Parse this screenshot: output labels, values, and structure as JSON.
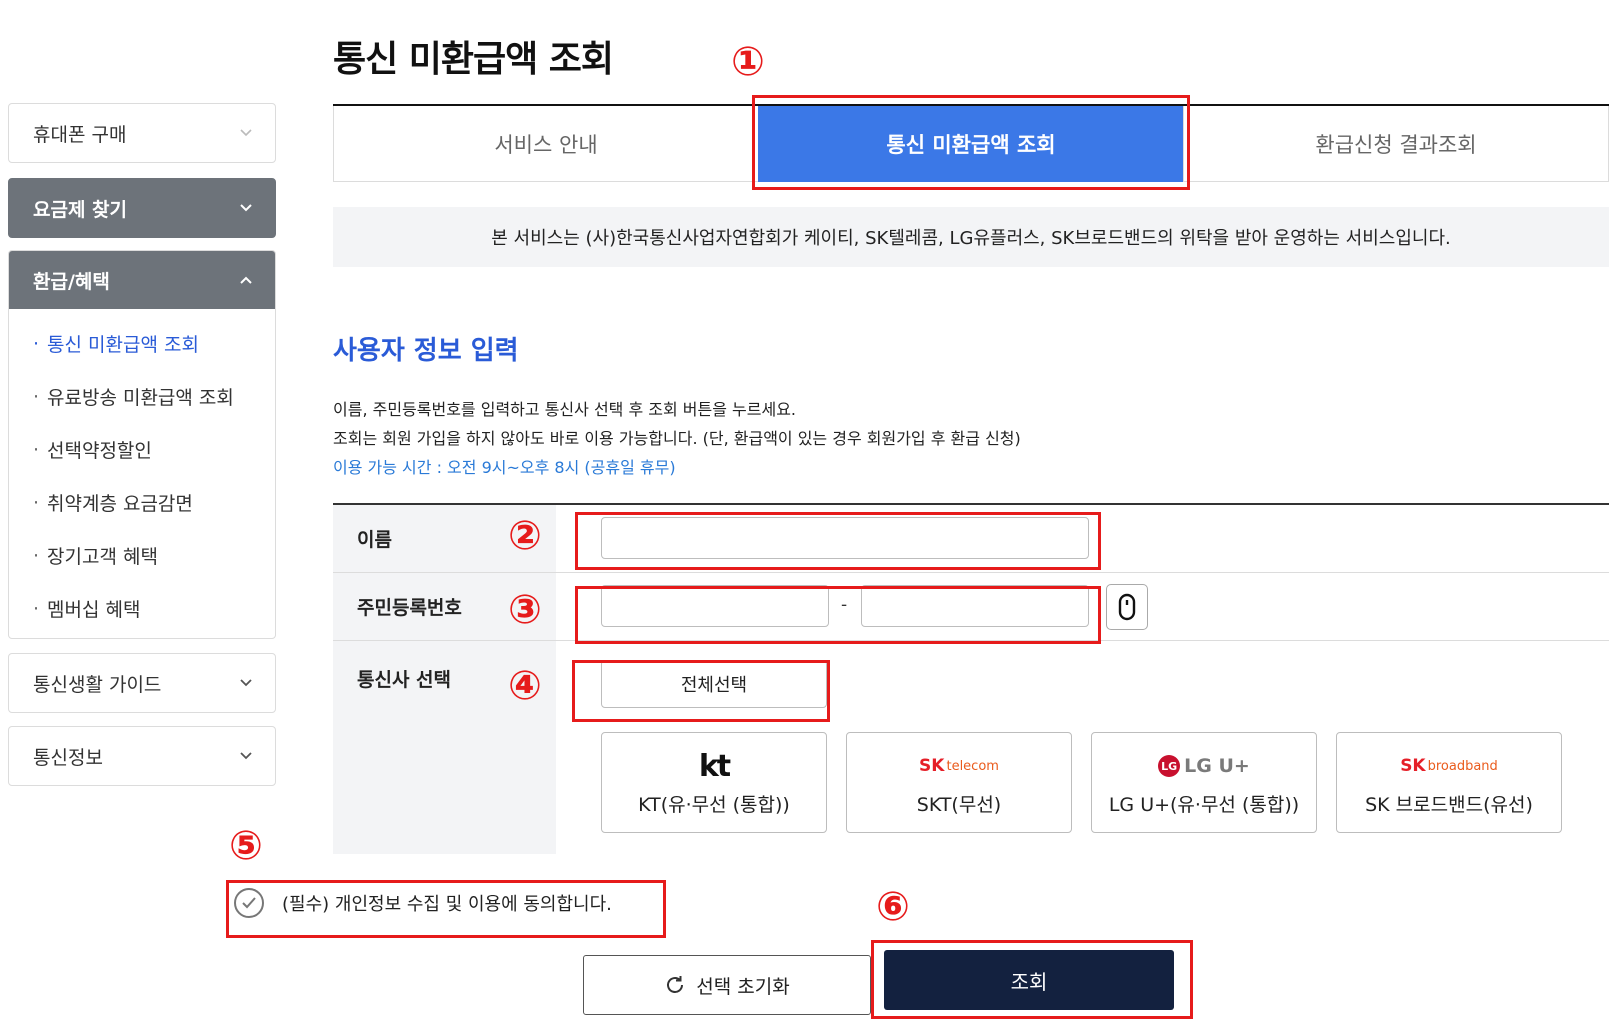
{
  "sidebar": {
    "menu1": "휴대폰 구매",
    "menu2": "요금제 찾기",
    "menu3": "환급/혜택",
    "submenu": [
      "통신 미환급액 조회",
      "유료방송 미환급액 조회",
      "선택약정할인",
      "취약계층 요금감면",
      "장기고객 혜택",
      "멤버십 혜택"
    ],
    "menu4": "통신생활 가이드",
    "menu5": "통신정보",
    "bullet": "·"
  },
  "page": {
    "title": "통신 미환급액 조회"
  },
  "tabs": [
    "서비스 안내",
    "통신 미환급액 조회",
    "환급신청 결과조회"
  ],
  "notice": "본 서비스는 (사)한국통신사업자연합회가 케이티, SK텔레콤, LG유플러스, SK브로드밴드의 위탁을 받아 운영하는 서비스입니다.",
  "section": {
    "title": "사용자 정보 입력",
    "desc1": "이름, 주민등록번호를 입력하고 통신사 선택 후 조회 버튼을 누르세요.",
    "desc2": "조회는 회원 가입을 하지 않아도 바로 이용 가능합니다. (단, 환급액이 있는 경우 회원가입 후 환급 신청)",
    "hours": "이용 가능 시간 : 오전 9시~오후 8시 (공휴일 휴무)"
  },
  "form": {
    "name_label": "이름",
    "rrn_label": "주민등록번호",
    "rrn_sep": "-",
    "carrier_label": "통신사 선택",
    "select_all": "전체선택",
    "carriers": [
      {
        "logo": "kt",
        "name": "KT(유·무선 (통합))"
      },
      {
        "logo_main": "SK",
        "logo_tail": "telecom",
        "name": "SKT(무선)"
      },
      {
        "logo_circle": "LG",
        "logo_text": "LG U+",
        "name": "LG U+(유·무선 (통합))"
      },
      {
        "logo_main": "SK",
        "logo_tail": "broadband",
        "name": "SK 브로드밴드(유선)"
      }
    ]
  },
  "agree": "(필수) 개인정보 수집 및 이용에 동의합니다.",
  "buttons": {
    "reset": "선택 초기화",
    "search": "조회"
  },
  "annotations": [
    "①",
    "②",
    "③",
    "④",
    "⑤",
    "⑥"
  ],
  "colors": {
    "tab_active": "#3b78e7",
    "accent_blue": "#2a5bd7",
    "search_button": "#13213f",
    "annotation_red": "#e61b1b",
    "sidebar_dark": "#6d737a"
  }
}
